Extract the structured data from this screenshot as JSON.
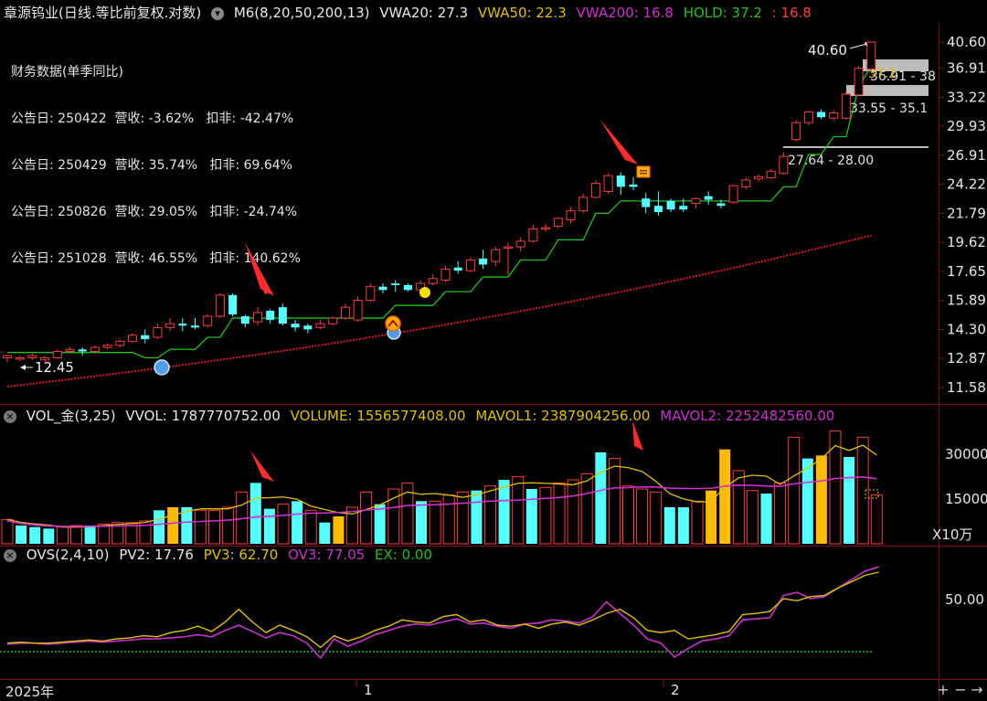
{
  "main_header": {
    "title": "章源钨业(日线.等比前复权.对数)",
    "indicator": "M6(8,20,50,200,13)",
    "vwa20": "VWA20: 27.3",
    "vwa50": "VWA50: 22.3",
    "vwa200": "VWA200: 16.8",
    "hold": "HOLD: 37.2",
    "hold_extra": ": 16.8"
  },
  "financial": {
    "title": "财务数据(单季同比)",
    "rows": [
      "公告日: 250422  营收: -3.62%   扣非: -42.47%",
      "公告日: 250429  营收: 35.74%   扣非: 69.64%",
      "公告日: 250826  营收: 29.05%   扣非: -24.74%",
      "公告日: 251028  营收: 46.55%   扣非: 140.62%"
    ]
  },
  "price_axis": [
    "40.60",
    "36.91",
    "33.22",
    "29.93",
    "26.91",
    "24.22",
    "21.79",
    "19.62",
    "17.65",
    "15.89",
    "14.30",
    "12.87",
    "11.58"
  ],
  "annotations": {
    "high": "40.60",
    "low": "12.45",
    "zone_1": "36.91 - 38",
    "zone_value": "37.2",
    "zone_2": "33.55 - 35.1",
    "zone_3": "27.64 - 28.00"
  },
  "vol_header": {
    "title": "VOL_金(3,25)",
    "vvol": "VVOL: 1787770752.00",
    "volume": "VOLUME: 1556577408.00",
    "mavol1": "MAVOL1: 2387904256.00",
    "mavol2": "MAVOL2: 2252482560.00"
  },
  "vol_axis": [
    "30000",
    "15000"
  ],
  "vol_unit": "X10万",
  "ovs_header": {
    "title": "OVS(2,4,10)",
    "pv2": "PV2: 17.76",
    "pv3": "PV3: 62.70",
    "ov3": "OV3: 77.05",
    "ex": "EX: 0.00"
  },
  "ovs_axis": [
    "50.00"
  ],
  "time_axis": {
    "year": "2025年",
    "m1": "1",
    "m2": "2"
  },
  "buttons": {
    "plus": "+",
    "minus": "−",
    "right": "→"
  },
  "colors": {
    "up": "#ff3b3b",
    "down": "#54ffff",
    "vwa20": "#1fc21f",
    "vwa50": "#e0c000",
    "vwa200": "#d02fd0",
    "ma_red": "#e0102a",
    "orange": "#ffbb00"
  },
  "candles": [
    [
      12.9,
      13.0,
      12.7,
      13.05
    ],
    [
      12.85,
      12.9,
      12.75,
      13.0
    ],
    [
      12.9,
      13.0,
      12.8,
      13.1
    ],
    [
      12.8,
      12.9,
      12.7,
      13.0
    ],
    [
      12.9,
      13.2,
      12.85,
      13.3
    ],
    [
      13.2,
      13.3,
      13.1,
      13.4
    ],
    [
      13.3,
      13.2,
      13.0,
      13.4
    ],
    [
      13.2,
      13.4,
      13.1,
      13.5
    ],
    [
      13.4,
      13.5,
      13.3,
      13.6
    ],
    [
      13.5,
      13.7,
      13.4,
      13.8
    ],
    [
      13.7,
      14.0,
      13.6,
      14.1
    ],
    [
      14.0,
      13.8,
      13.6,
      14.3
    ],
    [
      13.9,
      14.4,
      13.8,
      14.6
    ],
    [
      14.4,
      14.6,
      14.2,
      14.9
    ],
    [
      14.6,
      14.5,
      14.2,
      14.9
    ],
    [
      14.5,
      14.4,
      14.3,
      14.9
    ],
    [
      14.5,
      15.0,
      14.4,
      15.1
    ],
    [
      15.0,
      16.2,
      14.9,
      16.3
    ],
    [
      16.2,
      15.1,
      15.0,
      16.3
    ],
    [
      15.0,
      14.6,
      14.4,
      15.1
    ],
    [
      14.7,
      15.2,
      14.5,
      15.5
    ],
    [
      15.3,
      14.8,
      14.6,
      15.4
    ],
    [
      15.5,
      14.6,
      14.5,
      15.7
    ],
    [
      14.6,
      14.4,
      14.2,
      14.8
    ],
    [
      14.5,
      14.3,
      14.1,
      14.6
    ],
    [
      14.4,
      14.6,
      14.3,
      14.8
    ],
    [
      14.6,
      14.9,
      14.5,
      15.0
    ],
    [
      14.9,
      15.5,
      14.8,
      15.7
    ],
    [
      14.8,
      15.9,
      14.7,
      16.1
    ],
    [
      15.9,
      16.7,
      15.8,
      16.9
    ],
    [
      16.7,
      16.5,
      16.3,
      16.9
    ],
    [
      16.9,
      16.8,
      16.4,
      17.1
    ],
    [
      16.8,
      16.5,
      16.4,
      16.9
    ],
    [
      16.5,
      16.9,
      16.4,
      17.1
    ],
    [
      16.9,
      17.2,
      16.8,
      17.5
    ],
    [
      17.1,
      17.8,
      17.0,
      18.0
    ],
    [
      17.9,
      17.7,
      17.5,
      18.3
    ],
    [
      17.7,
      18.4,
      17.6,
      18.6
    ],
    [
      18.5,
      18.1,
      17.8,
      19.1
    ],
    [
      18.3,
      19.1,
      18.0,
      19.3
    ],
    [
      19.2,
      19.3,
      17.4,
      19.6
    ],
    [
      19.3,
      19.7,
      19.0,
      20.0
    ],
    [
      19.7,
      20.6,
      19.6,
      20.9
    ],
    [
      20.6,
      20.7,
      20.4,
      21.0
    ],
    [
      20.8,
      21.4,
      20.6,
      21.5
    ],
    [
      21.3,
      22.0,
      21.0,
      22.3
    ],
    [
      22.0,
      23.1,
      21.8,
      23.4
    ],
    [
      23.1,
      24.3,
      23.0,
      24.6
    ],
    [
      23.6,
      25.0,
      23.4,
      25.2
    ],
    [
      25.0,
      24.0,
      23.3,
      25.3
    ],
    [
      24.2,
      24.0,
      23.7,
      24.9
    ],
    [
      23.0,
      22.3,
      21.8,
      23.5
    ],
    [
      22.4,
      21.9,
      21.6,
      23.6
    ],
    [
      22.8,
      22.1,
      21.9,
      23.0
    ],
    [
      22.4,
      22.1,
      21.9,
      23.0
    ],
    [
      22.6,
      23.0,
      22.2,
      23.1
    ],
    [
      23.2,
      22.9,
      22.5,
      23.6
    ],
    [
      22.6,
      22.4,
      22.2,
      22.9
    ],
    [
      22.7,
      24.1,
      22.6,
      24.2
    ],
    [
      24.0,
      24.6,
      23.8,
      24.8
    ],
    [
      24.7,
      24.9,
      24.5,
      25.1
    ],
    [
      24.8,
      25.4,
      24.7,
      25.6
    ],
    [
      25.2,
      26.8,
      25.1,
      27.2
    ],
    [
      28.5,
      30.3,
      28.3,
      30.6
    ],
    [
      30.3,
      31.5,
      30.0,
      31.6
    ],
    [
      31.5,
      30.9,
      30.7,
      31.8
    ],
    [
      30.8,
      31.4,
      30.5,
      31.7
    ],
    [
      30.8,
      33.6,
      30.6,
      34.0
    ],
    [
      33.5,
      36.9,
      33.4,
      37.2
    ],
    [
      36.8,
      40.6,
      36.5,
      40.7
    ]
  ],
  "volumes": [
    [
      true,
      8000
    ],
    [
      false,
      6000
    ],
    [
      false,
      5500
    ],
    [
      false,
      5000
    ],
    [
      true,
      5500
    ],
    [
      true,
      6000
    ],
    [
      false,
      6000
    ],
    [
      true,
      6500
    ],
    [
      true,
      7000
    ],
    [
      true,
      7000
    ],
    [
      true,
      7500
    ],
    [
      false,
      11000
    ],
    [
      true,
      12000
    ],
    [
      false,
      12000
    ],
    [
      true,
      11000
    ],
    [
      true,
      11000
    ],
    [
      true,
      12000
    ],
    [
      true,
      17000
    ],
    [
      false,
      20000
    ],
    [
      false,
      11500
    ],
    [
      true,
      13000
    ],
    [
      false,
      14000
    ],
    [
      true,
      11000
    ],
    [
      false,
      7000
    ],
    [
      true,
      9000
    ],
    [
      true,
      12000
    ],
    [
      true,
      17000
    ],
    [
      false,
      13000
    ],
    [
      true,
      18000
    ],
    [
      true,
      20000
    ],
    [
      false,
      14000
    ],
    [
      true,
      14000
    ],
    [
      true,
      16000
    ],
    [
      true,
      17000
    ],
    [
      false,
      17500
    ],
    [
      true,
      19000
    ],
    [
      false,
      21000
    ],
    [
      true,
      22000
    ],
    [
      false,
      18000
    ],
    [
      true,
      18500
    ],
    [
      true,
      20000
    ],
    [
      true,
      21000
    ],
    [
      true,
      23000
    ],
    [
      false,
      30000
    ],
    [
      true,
      28000
    ],
    [
      true,
      19000
    ],
    [
      true,
      18000
    ],
    [
      true,
      17000
    ],
    [
      false,
      12000
    ],
    [
      false,
      12000
    ],
    [
      true,
      14000
    ],
    [
      true,
      17500
    ],
    [
      true,
      31000
    ],
    [
      true,
      24000
    ],
    [
      true,
      17500
    ],
    [
      false,
      16500
    ],
    [
      true,
      20000
    ],
    [
      true,
      35000
    ],
    [
      false,
      28000
    ],
    [
      true,
      29000
    ],
    [
      true,
      37000
    ],
    [
      false,
      28500
    ],
    [
      true,
      35000
    ],
    [
      true,
      16000
    ]
  ],
  "orange_bars": [
    12,
    24,
    51,
    52,
    59
  ],
  "pv": [
    8,
    9,
    8,
    8,
    9,
    10,
    11,
    10,
    12,
    13,
    15,
    14,
    18,
    20,
    24,
    19,
    28,
    40,
    28,
    18,
    25,
    20,
    14,
    4,
    15,
    10,
    14,
    20,
    24,
    30,
    28,
    27,
    33,
    35,
    28,
    30,
    25,
    24,
    26,
    22,
    26,
    28,
    25,
    30,
    36,
    40,
    32,
    20,
    18,
    20,
    12,
    14,
    16,
    19,
    35,
    36,
    38,
    50,
    48,
    52,
    53,
    60,
    66,
    72,
    75
  ],
  "ov": [
    7,
    8,
    8,
    7,
    8,
    9,
    10,
    9,
    10,
    11,
    12,
    12,
    13,
    14,
    16,
    14,
    20,
    25,
    19,
    13,
    18,
    15,
    8,
    -6,
    12,
    5,
    10,
    16,
    20,
    24,
    26,
    25,
    28,
    31,
    26,
    27,
    24,
    22,
    26,
    27,
    30,
    29,
    27,
    33,
    47,
    36,
    25,
    12,
    8,
    -5,
    3,
    10,
    12,
    15,
    30,
    31,
    32,
    53,
    56,
    50,
    52,
    60,
    68,
    76,
    80
  ]
}
